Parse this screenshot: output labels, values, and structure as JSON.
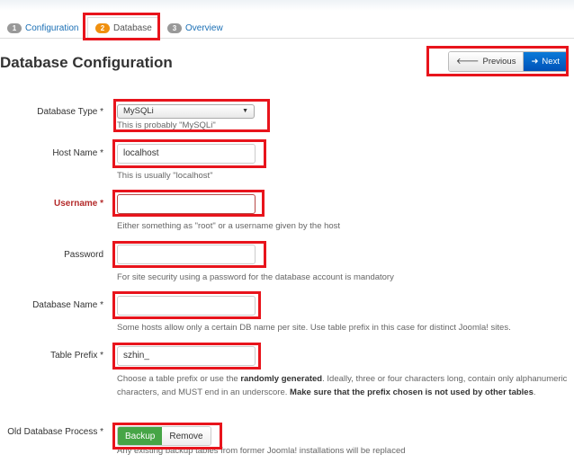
{
  "steps": [
    {
      "num": "1",
      "label": "Configuration"
    },
    {
      "num": "2",
      "label": "Database",
      "active": true
    },
    {
      "num": "3",
      "label": "Overview"
    }
  ],
  "title": "Database Configuration",
  "nav": {
    "previous": "Previous",
    "next": "Next"
  },
  "fields": {
    "db_type": {
      "label": "Database Type *",
      "value": "MySQLi",
      "help": "This is probably \"MySQLi\""
    },
    "host": {
      "label": "Host Name *",
      "value": "localhost",
      "help": "This is usually \"localhost\""
    },
    "username": {
      "label": "Username *",
      "value": "",
      "help": "Either something as \"root\" or a username given by the host"
    },
    "password": {
      "label": "Password",
      "value": "",
      "help": "For site security using a password for the database account is mandatory"
    },
    "db_name": {
      "label": "Database Name *",
      "value": "",
      "help": "Some hosts allow only a certain DB name per site. Use table prefix in this case for distinct Joomla! sites."
    },
    "prefix": {
      "label": "Table Prefix *",
      "value": "szhin_",
      "help_1": "Choose a table prefix or use the ",
      "help_bold_1": "randomly generated",
      "help_2": ". Ideally, three or four characters long, contain only alphanumeric characters, and MUST end in an underscore. ",
      "help_bold_2": "Make sure that the prefix chosen is not used by other tables",
      "help_3": "."
    },
    "old_db": {
      "label": "Old Database Process *",
      "options": [
        "Backup",
        "Remove"
      ],
      "selected": "Backup",
      "help": "Any existing backup tables from former Joomla! installations will be replaced"
    }
  },
  "colors": {
    "highlight": "#e8141c",
    "active_badge": "#f0900f",
    "next_button": "#0a6fd0",
    "backup_on": "#46a546"
  }
}
